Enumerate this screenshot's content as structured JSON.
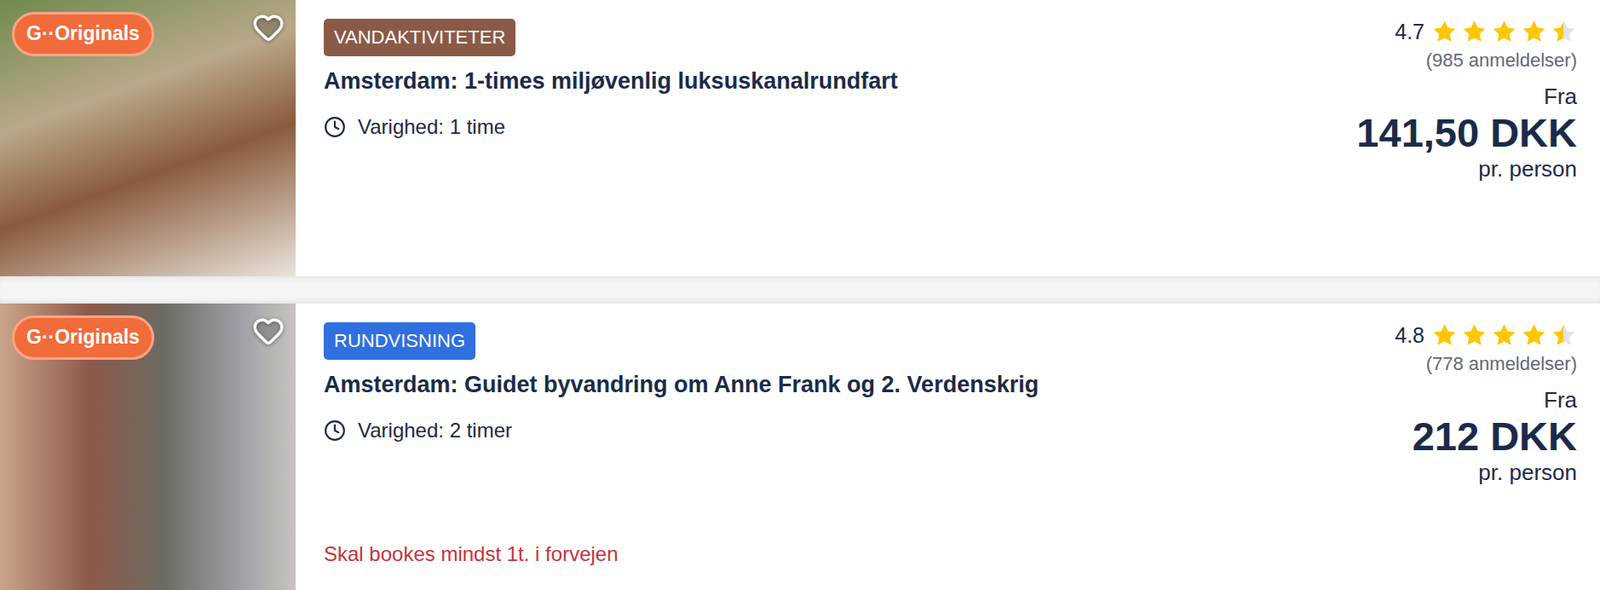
{
  "cards": [
    {
      "badge": "G··Originals",
      "favorite": false,
      "category": {
        "label": "VANDAKTIVITETER",
        "color": "#8a5a46"
      },
      "title": "Amsterdam: 1-times miljøvenlig luksuskanalrundfart",
      "duration": "Varighed: 1 time",
      "rating": "4.7",
      "stars": 4.5,
      "reviews": "(985 anmeldelser)",
      "price_prefix": "Fra",
      "price": "141,50 DKK",
      "price_suffix": "pr. person"
    },
    {
      "badge": "G··Originals",
      "favorite": false,
      "category": {
        "label": "RUNDVISNING",
        "color": "#2f6fe0"
      },
      "title": "Amsterdam: Guidet byvandring om Anne Frank og 2. Verdenskrig",
      "duration": "Varighed: 2 timer",
      "rating": "4.8",
      "stars": 4.5,
      "reviews": "(778 anmeldelser)",
      "price_prefix": "Fra",
      "price": "212 DKK",
      "price_suffix": "pr. person",
      "notice": "Skal bookes mindst 1t. i forvejen"
    }
  ]
}
